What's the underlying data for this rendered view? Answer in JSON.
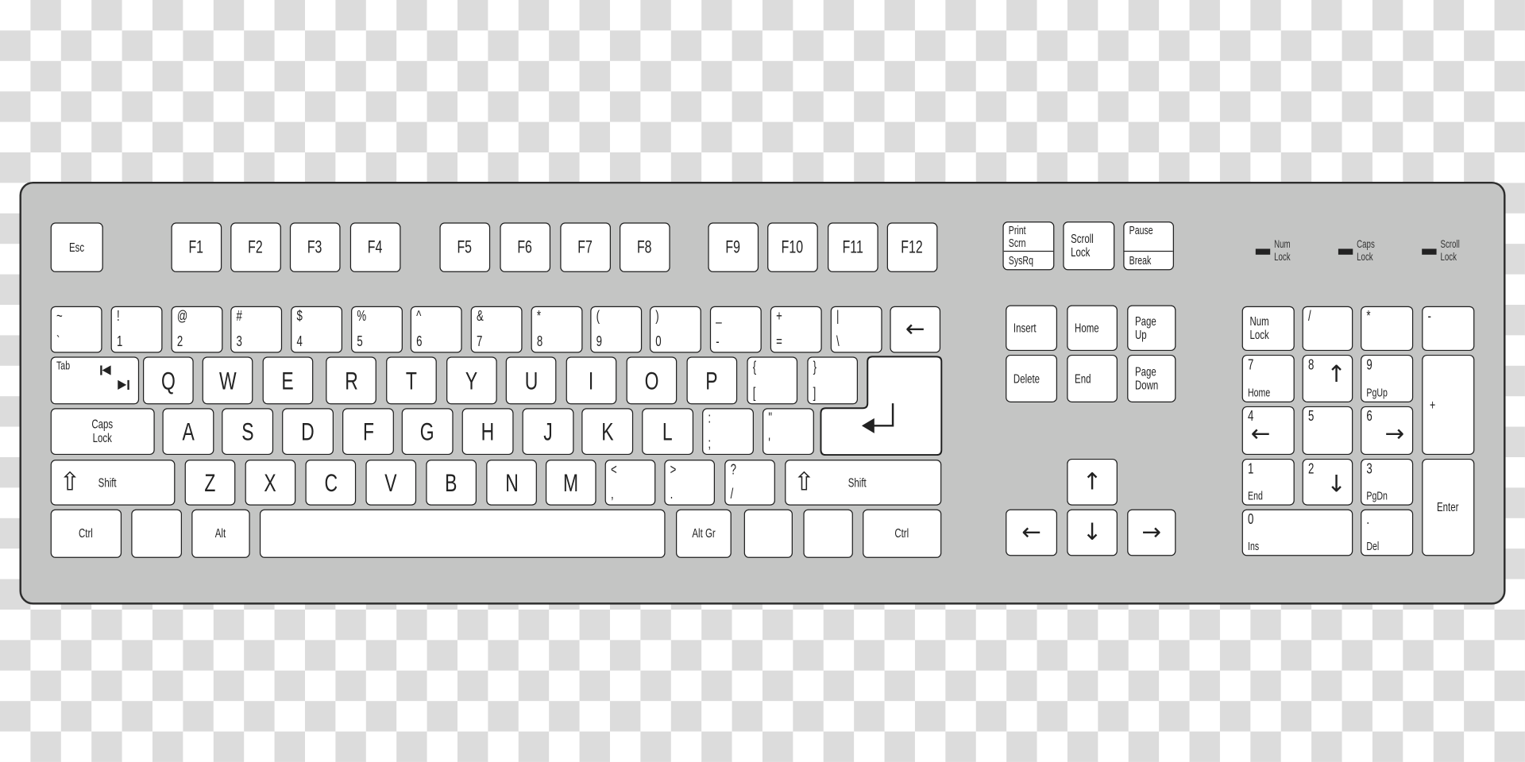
{
  "colors": {
    "body": "#c4c5c4",
    "key": "#ffffff",
    "outline": "#1e1e1e"
  },
  "leds": [
    {
      "label": "Num\nLock"
    },
    {
      "label": "Caps\nLock"
    },
    {
      "label": "Scroll\nLock"
    }
  ],
  "keys": [
    {
      "id": "esc",
      "label": "Esc"
    },
    {
      "id": "f1",
      "label": "F1"
    },
    {
      "id": "f2",
      "label": "F2"
    },
    {
      "id": "f3",
      "label": "F3"
    },
    {
      "id": "f4",
      "label": "F4"
    },
    {
      "id": "f5",
      "label": "F5"
    },
    {
      "id": "f6",
      "label": "F6"
    },
    {
      "id": "f7",
      "label": "F7"
    },
    {
      "id": "f8",
      "label": "F8"
    },
    {
      "id": "f9",
      "label": "F9"
    },
    {
      "id": "f10",
      "label": "F10"
    },
    {
      "id": "f11",
      "label": "F11"
    },
    {
      "id": "f12",
      "label": "F12"
    },
    {
      "id": "print-screen",
      "top": "Print\nScrn",
      "bottom": "SysRq"
    },
    {
      "id": "scroll-lock",
      "label": "Scroll\nLock"
    },
    {
      "id": "pause",
      "top": "Pause",
      "bottom": "Break"
    },
    {
      "id": "grave",
      "top": "~",
      "bottom": "`"
    },
    {
      "id": "1",
      "top": "!",
      "bottom": "1"
    },
    {
      "id": "2",
      "top": "@",
      "bottom": "2"
    },
    {
      "id": "3",
      "top": "#",
      "bottom": "3"
    },
    {
      "id": "4",
      "top": "$",
      "bottom": "4"
    },
    {
      "id": "5",
      "top": "%",
      "bottom": "5"
    },
    {
      "id": "6",
      "top": "^",
      "bottom": "6"
    },
    {
      "id": "7",
      "top": "&",
      "bottom": "7"
    },
    {
      "id": "8",
      "top": "*",
      "bottom": "8"
    },
    {
      "id": "9",
      "top": "(",
      "bottom": "9"
    },
    {
      "id": "0",
      "top": ")",
      "bottom": "0"
    },
    {
      "id": "minus",
      "top": "_",
      "bottom": "-"
    },
    {
      "id": "equal",
      "top": "+",
      "bottom": "="
    },
    {
      "id": "backslash",
      "top": "|",
      "bottom": "\\"
    },
    {
      "id": "backspace",
      "icon": "←",
      "icon_name": "arrow-left-icon"
    },
    {
      "id": "tab",
      "label": "Tab"
    },
    {
      "id": "q",
      "label": "Q"
    },
    {
      "id": "w",
      "label": "W"
    },
    {
      "id": "e",
      "label": "E"
    },
    {
      "id": "r",
      "label": "R"
    },
    {
      "id": "t",
      "label": "T"
    },
    {
      "id": "y",
      "label": "Y"
    },
    {
      "id": "u",
      "label": "U"
    },
    {
      "id": "i",
      "label": "I"
    },
    {
      "id": "o",
      "label": "O"
    },
    {
      "id": "p",
      "label": "P"
    },
    {
      "id": "lbracket",
      "top": "{",
      "bottom": "["
    },
    {
      "id": "rbracket",
      "top": "}",
      "bottom": "]"
    },
    {
      "id": "caps-lock",
      "label": "Caps\nLock"
    },
    {
      "id": "a",
      "label": "A"
    },
    {
      "id": "s",
      "label": "S"
    },
    {
      "id": "d",
      "label": "D"
    },
    {
      "id": "f",
      "label": "F"
    },
    {
      "id": "g",
      "label": "G"
    },
    {
      "id": "h",
      "label": "H"
    },
    {
      "id": "j",
      "label": "J"
    },
    {
      "id": "k",
      "label": "K"
    },
    {
      "id": "l",
      "label": "L"
    },
    {
      "id": "semicolon",
      "top": ":",
      "bottom": ";"
    },
    {
      "id": "quote",
      "top": "\"",
      "bottom": "'"
    },
    {
      "id": "left-shift",
      "label": "Shift",
      "icon": "⇧",
      "icon_name": "shift-arrow-icon"
    },
    {
      "id": "z",
      "label": "Z"
    },
    {
      "id": "x",
      "label": "X"
    },
    {
      "id": "c",
      "label": "C"
    },
    {
      "id": "v",
      "label": "V"
    },
    {
      "id": "b",
      "label": "B"
    },
    {
      "id": "n",
      "label": "N"
    },
    {
      "id": "m",
      "label": "M"
    },
    {
      "id": "comma",
      "top": "<",
      "bottom": ","
    },
    {
      "id": "period",
      "top": ">",
      "bottom": "."
    },
    {
      "id": "slash",
      "top": "?",
      "bottom": "/"
    },
    {
      "id": "right-shift",
      "label": "Shift",
      "icon": "⇧",
      "icon_name": "shift-arrow-icon"
    },
    {
      "id": "left-ctrl",
      "label": "Ctrl"
    },
    {
      "id": "win",
      "label": ""
    },
    {
      "id": "alt",
      "label": "Alt"
    },
    {
      "id": "space",
      "label": ""
    },
    {
      "id": "alt-gr",
      "label": "Alt Gr"
    },
    {
      "id": "right-win",
      "label": ""
    },
    {
      "id": "menu",
      "label": ""
    },
    {
      "id": "right-ctrl",
      "label": "Ctrl"
    },
    {
      "id": "insert",
      "label": "Insert"
    },
    {
      "id": "home",
      "label": "Home"
    },
    {
      "id": "page-up",
      "label": "Page\nUp"
    },
    {
      "id": "delete",
      "label": "Delete"
    },
    {
      "id": "end",
      "label": "End"
    },
    {
      "id": "page-down",
      "label": "Page\nDown"
    },
    {
      "id": "up",
      "icon": "↑",
      "icon_name": "arrow-up-icon"
    },
    {
      "id": "left",
      "icon": "←",
      "icon_name": "arrow-left-icon"
    },
    {
      "id": "down",
      "icon": "↓",
      "icon_name": "arrow-down-icon"
    },
    {
      "id": "right",
      "icon": "→",
      "icon_name": "arrow-right-icon"
    },
    {
      "id": "num-lock",
      "label": "Num\nLock"
    },
    {
      "id": "num-slash",
      "top": "/"
    },
    {
      "id": "num-star",
      "top": "*"
    },
    {
      "id": "num-minus",
      "top": "-"
    },
    {
      "id": "num-7",
      "top": "7",
      "bottom": "Home"
    },
    {
      "id": "num-8",
      "top": "8",
      "icon": "↑",
      "icon_name": "arrow-up-icon"
    },
    {
      "id": "num-9",
      "top": "9",
      "bottom": "PgUp"
    },
    {
      "id": "num-plus",
      "label": "+"
    },
    {
      "id": "num-4",
      "top": "4",
      "icon": "←",
      "icon_name": "arrow-left-icon"
    },
    {
      "id": "num-5",
      "top": "5"
    },
    {
      "id": "num-6",
      "top": "6",
      "icon": "→",
      "icon_name": "arrow-right-icon"
    },
    {
      "id": "num-1",
      "top": "1",
      "bottom": "End"
    },
    {
      "id": "num-2",
      "top": "2",
      "icon": "↓",
      "icon_name": "arrow-down-icon"
    },
    {
      "id": "num-3",
      "top": "3",
      "bottom": "PgDn"
    },
    {
      "id": "num-enter",
      "label": "Enter"
    },
    {
      "id": "num-0",
      "top": "0",
      "bottom": "Ins"
    },
    {
      "id": "num-dot",
      "top": ".",
      "bottom": "Del"
    }
  ],
  "enter": {
    "icon": "↵",
    "icon_name": "enter-arrow-icon"
  }
}
